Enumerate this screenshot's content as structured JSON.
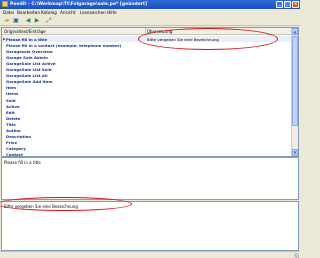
{
  "window": {
    "title": "Poedit - C:\\Werkmap\\Tt\\Folgarage\\sale.po* [geändert]",
    "buttons": {
      "minimize": "_",
      "maximize": "□",
      "close": "×"
    }
  },
  "menu": [
    "Datei",
    "Bearbeiten",
    "Katalog",
    "Ansicht",
    "Lesezeichen",
    "Hilfe"
  ],
  "toolbar": {
    "icons": [
      "folder-open-icon",
      "save-icon",
      "previous-icon",
      "next-icon",
      "fit-icon"
    ],
    "glyphs": {
      "open": "▰",
      "save": "▣",
      "prev": "◀",
      "next": "▶",
      "fit": "⤢"
    }
  },
  "list": {
    "headers": {
      "source": "Originaltext/Einträge",
      "translation": "Übersetzung"
    },
    "rows": [
      {
        "source": "Please fill in a title",
        "translation": "Bitte vergeben Sie eine Bezeichnung",
        "selected": true
      },
      {
        "source": "Please fill in a contact (example: telephone number)",
        "translation": ""
      },
      {
        "source": "Garagesale Overview",
        "translation": ""
      },
      {
        "source": "Garage Sale Admin",
        "translation": ""
      },
      {
        "source": "GarageSale List Active",
        "translation": ""
      },
      {
        "source": "GarageSale List Sold",
        "translation": ""
      },
      {
        "source": "GarageSale List All",
        "translation": ""
      },
      {
        "source": "GarageSale Add Item",
        "translation": ""
      },
      {
        "source": "Item",
        "translation": ""
      },
      {
        "source": "Items",
        "translation": ""
      },
      {
        "source": "Sold",
        "translation": ""
      },
      {
        "source": "Active",
        "translation": ""
      },
      {
        "source": "Edit",
        "translation": ""
      },
      {
        "source": "Delete",
        "translation": ""
      },
      {
        "source": "Title",
        "translation": ""
      },
      {
        "source": "Author",
        "translation": ""
      },
      {
        "source": "Description",
        "translation": ""
      },
      {
        "source": "Price",
        "translation": ""
      },
      {
        "source": "Category",
        "translation": ""
      },
      {
        "source": "Contact",
        "translation": ""
      }
    ]
  },
  "source_text": "Please fill in a title",
  "translation_text": "Bitte vergeben Sie eine Bezeichnung",
  "colors": {
    "annotation": "#d8141c",
    "titlebar": "#2f6bd8",
    "source_text": "#1a2e8a"
  }
}
